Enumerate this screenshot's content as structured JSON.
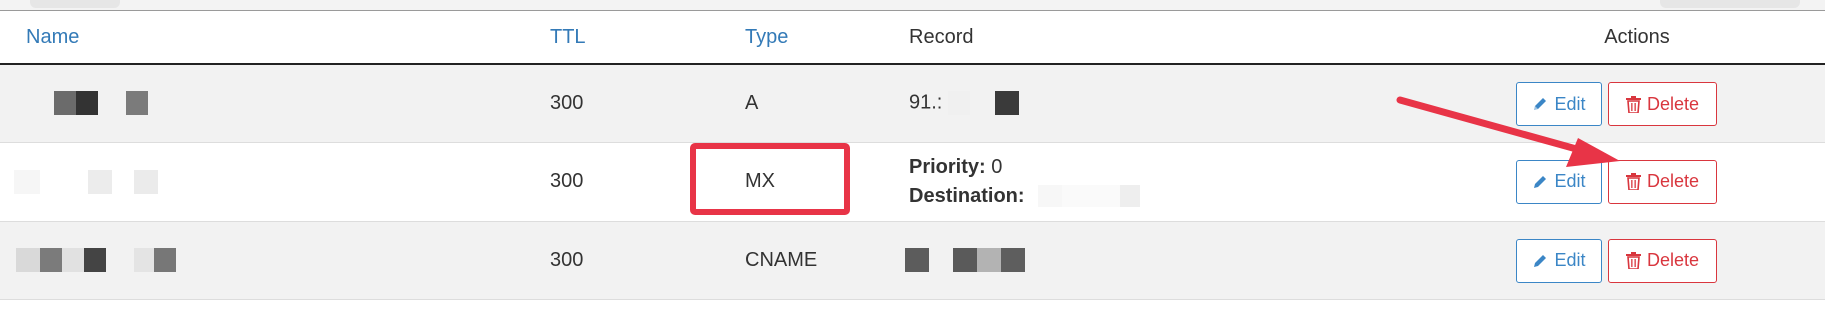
{
  "table": {
    "headers": {
      "name": "Name",
      "ttl": "TTL",
      "type": "Type",
      "record": "Record",
      "actions": "Actions"
    },
    "rows": [
      {
        "ttl": "300",
        "type": "A",
        "record_text": "91.:"
      },
      {
        "ttl": "300",
        "type": "MX",
        "priority_label": "Priority:",
        "priority_value": "0",
        "destination_label": "Destination:"
      },
      {
        "ttl": "300",
        "type": "CNAME"
      }
    ]
  },
  "buttons": {
    "edit_label": "Edit",
    "delete_label": "Delete"
  },
  "icons": {
    "edit": "pencil-icon",
    "delete": "trash-icon"
  },
  "colors": {
    "link_blue": "#337ab7",
    "edit_blue": "#3b86c6",
    "delete_red": "#d9363e",
    "annotation_red": "#e83447"
  }
}
